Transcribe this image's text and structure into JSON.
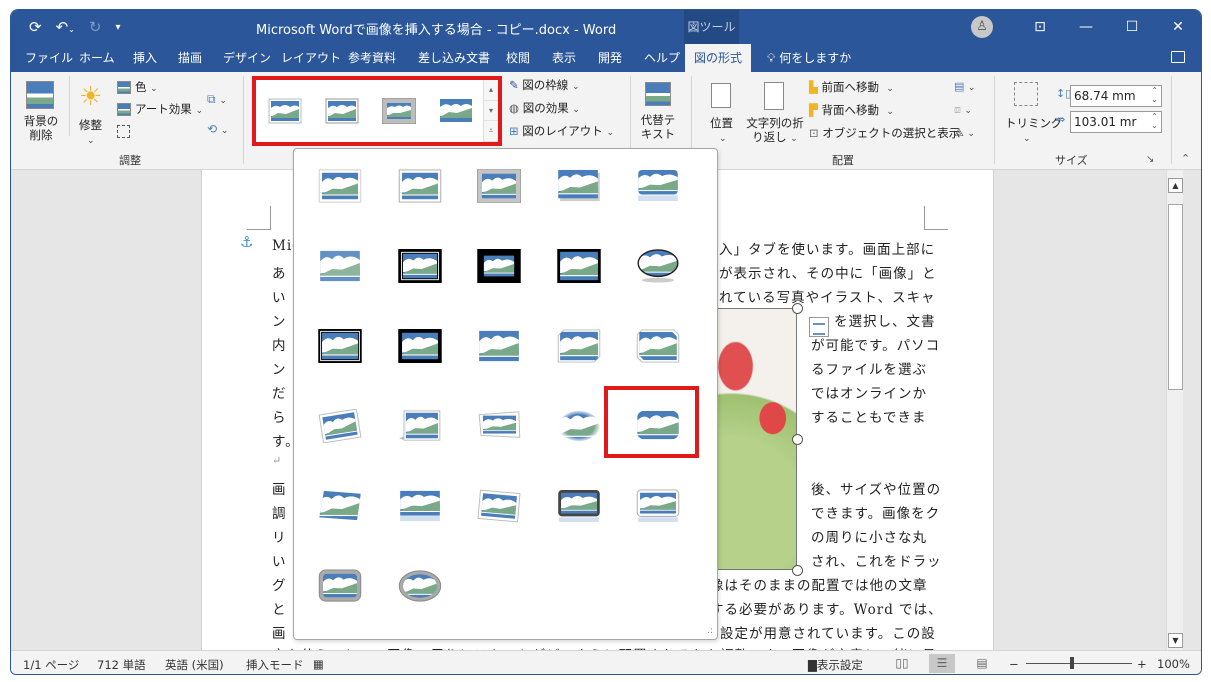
{
  "titlebar": {
    "title": "Microsoft Wordで画像を挿入する場合 - コピー.docx  -  Word",
    "context_tab": "図ツール",
    "qat": {
      "save_icon": "autosave-icon",
      "undo_icon": "undo-icon",
      "redo_icon": "redo-icon",
      "customize_icon": "customize-qat-icon"
    },
    "controls": {
      "account": "account-icon",
      "ribbon_display": "ribbon-display-icon",
      "minimize": "minimize-icon",
      "maximize": "maximize-icon",
      "close": "close-icon"
    }
  },
  "tabs": [
    {
      "label": "ファイル"
    },
    {
      "label": "ホーム"
    },
    {
      "label": "挿入"
    },
    {
      "label": "描画"
    },
    {
      "label": "デザイン"
    },
    {
      "label": "レイアウト"
    },
    {
      "label": "参考資料"
    },
    {
      "label": "差し込み文書"
    },
    {
      "label": "校閲"
    },
    {
      "label": "表示"
    },
    {
      "label": "開発"
    },
    {
      "label": "ヘルプ"
    },
    {
      "label": "図の形式",
      "active": true
    }
  ],
  "tell_me": "何をしますか",
  "ribbon": {
    "adjust": {
      "remove_bg": "背景の\n削除",
      "remove_bg_l1": "背景の",
      "remove_bg_l2": "削除",
      "corrections": "修整",
      "color": "色",
      "artistic": "アート効果",
      "group_label": "調整"
    },
    "styles": {
      "border": "図の枠線",
      "effects": "図の効果",
      "layout": "図のレイアウト"
    },
    "accessibility": {
      "alt_text_l1": "代替テ",
      "alt_text_l2": "キスト"
    },
    "arrange": {
      "position": "位置",
      "wrap_l1": "文字列の折",
      "wrap_l2": "り返し",
      "bring_forward": "前面へ移動",
      "send_backward": "背面へ移動",
      "selection_pane": "オブジェクトの選択と表示",
      "group_label": "配置"
    },
    "size": {
      "crop": "トリミング",
      "height": "68.74 mm",
      "width": "103.01 mr",
      "group_label": "サイズ"
    }
  },
  "gallery": {
    "styles": [
      "simple-frame-white",
      "beveled-matte-white",
      "metal-frame",
      "drop-shadow-rectangle",
      "reflected-rounded-rectangle",
      "soft-edge-rectangle",
      "double-frame-black",
      "thick-matte-black",
      "simple-frame-black",
      "beveled-oval-black",
      "compound-frame-black",
      "center-shadow-rectangle",
      "rounded-diagonal-corner-white",
      "snip-diagonal-corner-white",
      "moderate-frame-white",
      "rotated-white",
      "perspective-shadow-white",
      "relaxed-perspective-white",
      "soft-edge-oval",
      "bevel-rectangle",
      "bevel-perspective",
      "reflected-perspective-right",
      "bevel-perspective-left-white",
      "reflected-bevel-black",
      "reflected-bevel-white",
      "metal-rounded-rectangle",
      "metal-oval"
    ],
    "selected": "soft-edge-oval"
  },
  "document": {
    "lines_left": [
      "Mic",
      "あ",
      "い",
      "ン",
      "内",
      "ン",
      "だ",
      "ら",
      "す。",
      "↵",
      "画",
      "調",
      "リ",
      "い",
      "グ",
      "と",
      "画"
    ],
    "lines_right": [
      "入」タブを使います。画面上部に",
      "が表示され、その中に「画像」と",
      "れている写真やイラスト、スキャ",
      "を選択し、文書",
      "が可能です。パソコ",
      "るファイルを選ぶ",
      "ではオンラインか",
      "することもできま",
      "後、サイズや位置の",
      "できます。画像をク",
      "の周りに小さな丸",
      "され、これをドラッ",
      "像はそのままの配置では他の文章",
      "する必要があります。Word では、",
      "設定が用意されています。この設",
      "定を使うことで、画像の周りにテキストがどのように配置されるかを調整でき、画像が文章と一緒に見"
    ]
  },
  "statusbar": {
    "page": "1/1 ページ",
    "words": "712 単語",
    "language": "英語 (米国)",
    "mode": "挿入モード",
    "display_settings": "表示設定",
    "zoom_minus": "−",
    "zoom_plus": "+",
    "zoom": "100%",
    "zoom_level_percent": 100
  },
  "colors": {
    "accent": "#2b579a",
    "highlight": "#e0191a"
  }
}
